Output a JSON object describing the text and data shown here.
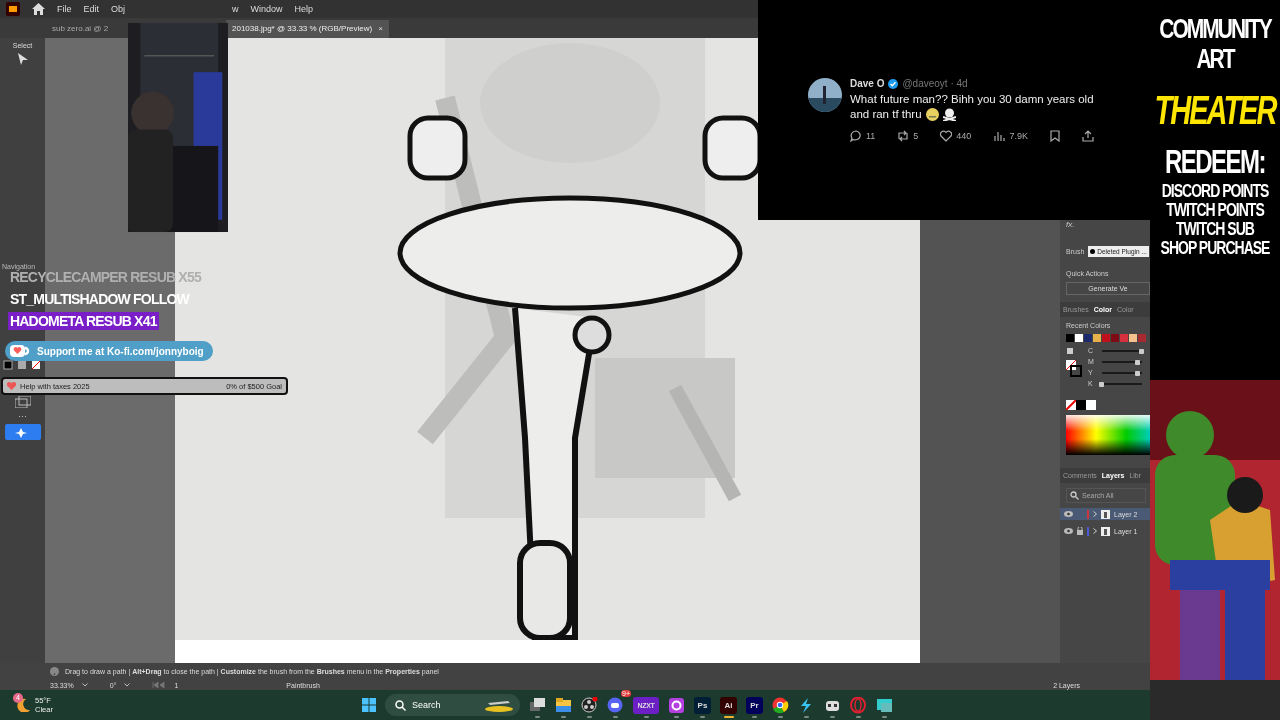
{
  "menu_bar": {
    "items": [
      "File",
      "Edit",
      "Obj",
      "w",
      "Window",
      "Help"
    ]
  },
  "document_tabs": [
    {
      "label": "sub zero.ai @ 2",
      "selected": false
    },
    {
      "label": "201038.jpg* @ 33.33 % (RGB/Preview)",
      "selected": true,
      "close": "×"
    }
  ],
  "toolbar": {
    "select_label": "Select",
    "navigation_label": "Navigation",
    "more": "···"
  },
  "alerts": [
    {
      "text": "RECYCLECAMPER  RESUB X55",
      "highlighted": false,
      "faded": true
    },
    {
      "text": "ST_MULTISHADOW  FOLLOW",
      "highlighted": false,
      "faded": false
    },
    {
      "text": "HADOMETA  RESUB X41",
      "highlighted": true,
      "faded": false
    }
  ],
  "kofi": {
    "text": "Support me at Ko-fi.com/jonnyboig"
  },
  "goal": {
    "label": "Help with taxes 2025",
    "reading": "0% of $500 Goal",
    "level": 0
  },
  "tweet": {
    "name": "Dave O",
    "handle": "@daveoyt · 4d",
    "text": [
      "What future man?? Bihh you 30 damn years old",
      "and ran tf thru"
    ],
    "replies": "11",
    "reposts": "5",
    "likes": "440",
    "views": "7.9K"
  },
  "properties": {
    "fx": "fx.",
    "brush_label": "Brush",
    "brush_value": "Deleted Plugin ...",
    "quick_actions": "Quick Actions",
    "generate": "Generate Ve",
    "tabs": [
      {
        "label": "Brushes",
        "selected": false
      },
      {
        "label": "Color",
        "selected": true
      },
      {
        "label": "Color",
        "selected": false
      }
    ],
    "recent_colors_label": "Recent Colors",
    "recent_colors": [
      {
        "color": "#000000"
      },
      {
        "color": "#ffffff"
      },
      {
        "color": "#1c2a6b"
      },
      {
        "color": "#e8b04a"
      },
      {
        "color": "#c0101c"
      },
      {
        "color": "#7e0a14"
      },
      {
        "color": "#d6303f"
      },
      {
        "color": "#f4c08e"
      },
      {
        "color": "#a82a30"
      }
    ],
    "channels": [
      {
        "name": "C",
        "level": 1
      },
      {
        "name": "M",
        "level": 0.9
      },
      {
        "name": "Y",
        "level": 0.9
      },
      {
        "name": "K",
        "level": 0
      }
    ],
    "panel_tabs": [
      {
        "label": "Comments",
        "selected": false
      },
      {
        "label": "Layers",
        "selected": true
      },
      {
        "label": "Libr",
        "selected": false
      }
    ],
    "search": {
      "placeholder": "Search All"
    },
    "layers": [
      {
        "name": "Layer 2",
        "selected": true,
        "locked": false,
        "color": "#d0343c"
      },
      {
        "name": "Layer 1",
        "selected": false,
        "locked": true,
        "color": "#4a5ad8"
      }
    ],
    "layer_count": "2 Layers"
  },
  "status": {
    "hint": "Drag to draw a path  |  **Alt+Drag** to close the path  |  **Customize** the brush from the **Brushes** menu in the **Properties** panel",
    "zoom": "33.33%",
    "rotation": "0°",
    "artboard": "1",
    "tool": "Paintbrush"
  },
  "side_panel": {
    "title": [
      "COMMUNITY",
      "ART"
    ],
    "subtitle": "THEATER",
    "redeem": [
      "REDEEM:",
      "DISCORD POINTS",
      "TWITCH POINTS",
      "TWITCH SUB",
      "SHOP PURCHASE"
    ]
  },
  "taskbar": {
    "weather": {
      "temp": "55°F",
      "condition": "Clear",
      "badge": "4"
    },
    "search": "Search",
    "apps": [
      {
        "kind": "taskview",
        "active": false
      },
      {
        "kind": "files",
        "active": false
      },
      {
        "kind": "obs",
        "active": false
      },
      {
        "kind": "discord",
        "badge": "9+",
        "active": false
      },
      {
        "kind": "label",
        "text": "NZXT",
        "color": "#6b1fc4",
        "active": false
      },
      {
        "kind": "ring",
        "active": false
      },
      {
        "kind": "label",
        "text": "Ps",
        "color": "#001e36",
        "active": false
      },
      {
        "kind": "label",
        "text": "Ai",
        "color": "#330000",
        "active": true
      },
      {
        "kind": "label",
        "text": "Pr",
        "color": "#00005b",
        "active": false
      },
      {
        "kind": "chrome",
        "active": false
      },
      {
        "kind": "bolt",
        "active": false
      },
      {
        "kind": "robot",
        "active": false
      },
      {
        "kind": "opera",
        "active": false
      },
      {
        "kind": "screen",
        "active": false
      }
    ]
  }
}
